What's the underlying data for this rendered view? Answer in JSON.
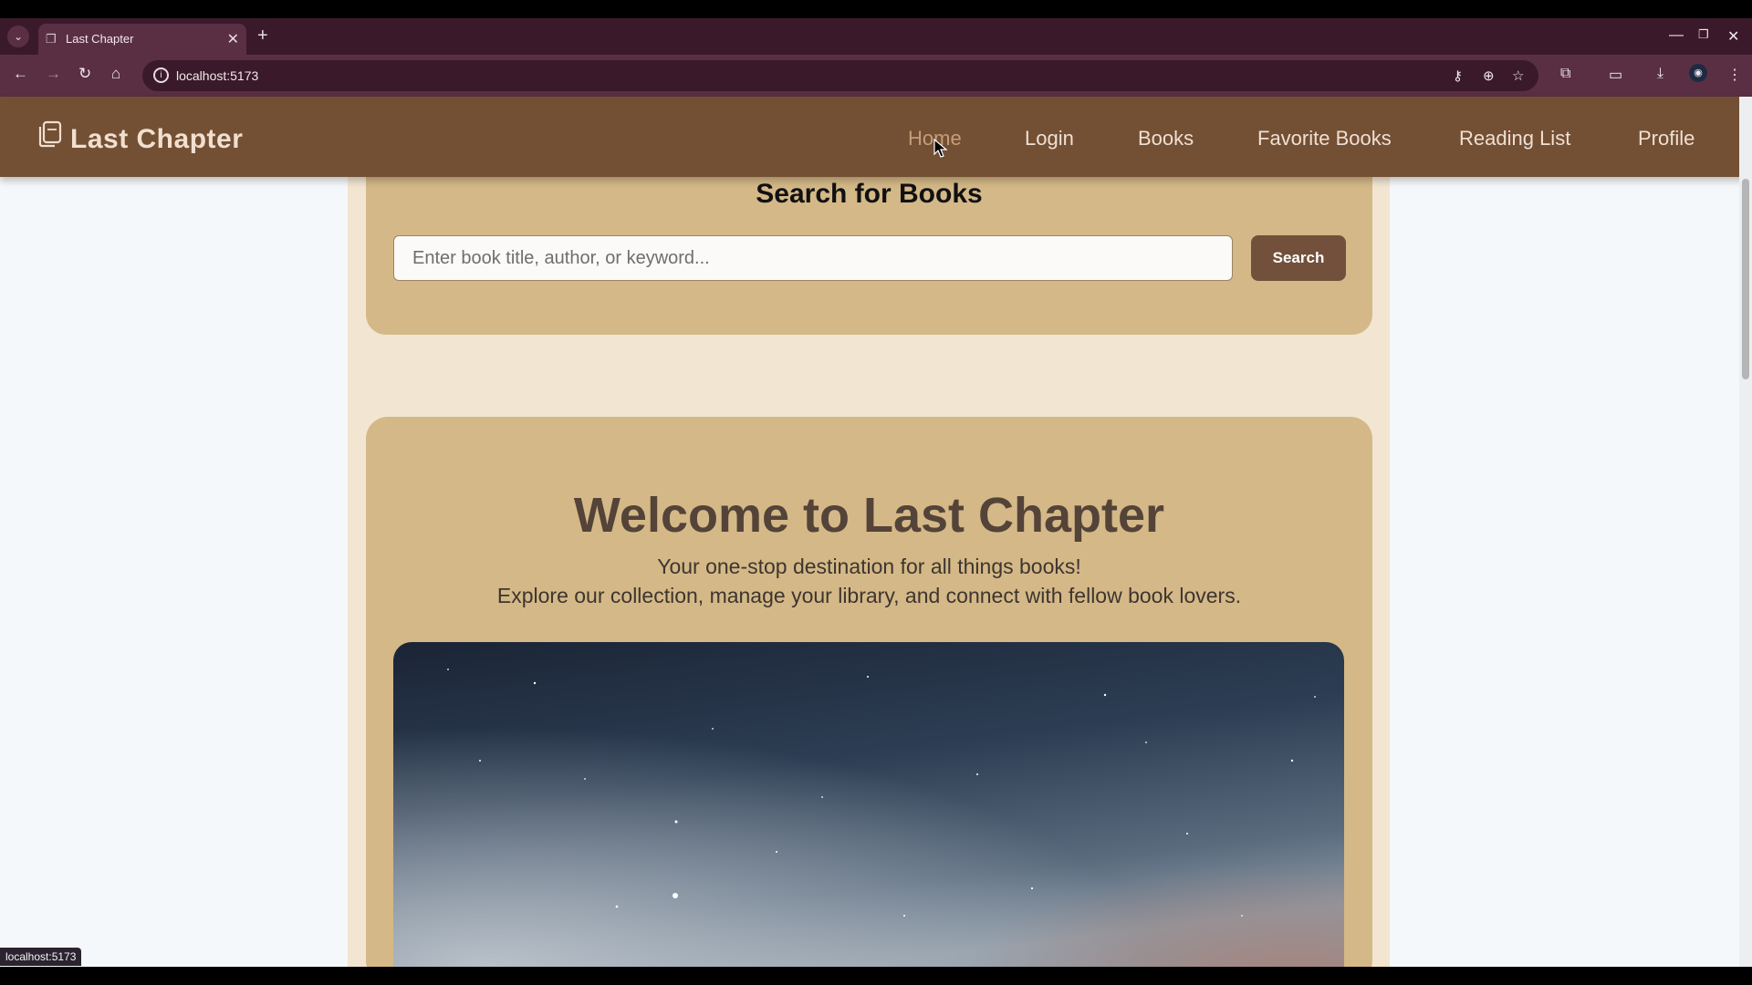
{
  "browser": {
    "tab_title": "Last Chapter",
    "url": "localhost:5173",
    "status_text": "localhost:5173",
    "icons": {
      "tab_list": "chevron-down-icon",
      "tab_favicon": "document-icon",
      "close_tab": "close-icon",
      "new_tab": "plus-icon",
      "back": "back-arrow-icon",
      "forward": "forward-arrow-icon",
      "reload": "reload-icon",
      "home": "home-icon",
      "site_info": "info-icon",
      "passwords": "key-icon",
      "zoom": "zoom-icon",
      "bookmark": "star-icon",
      "extensions": "puzzle-icon",
      "cast": "cast-icon",
      "downloads": "download-icon",
      "profile": "avatar-icon",
      "menu": "kebab-menu-icon"
    }
  },
  "app": {
    "brand": "Last Chapter",
    "nav": [
      {
        "label": "Home",
        "active": true
      },
      {
        "label": "Login",
        "active": false
      },
      {
        "label": "Books",
        "active": false
      },
      {
        "label": "Favorite Books",
        "active": false
      },
      {
        "label": "Reading List",
        "active": false
      },
      {
        "label": "Profile",
        "active": false
      }
    ]
  },
  "search": {
    "heading": "Search for Books",
    "placeholder": "Enter book title, author, or keyword...",
    "button_label": "Search"
  },
  "welcome": {
    "title": "Welcome to Last Chapter",
    "line1": "Your one-stop destination for all things books!",
    "line2": "Explore our collection, manage your library, and connect with fellow book lovers."
  },
  "colors": {
    "header": "#734f34",
    "card": "#d4b887",
    "column": "#f2e5d2",
    "button": "#72503b",
    "nav_active": "#c69d79"
  }
}
